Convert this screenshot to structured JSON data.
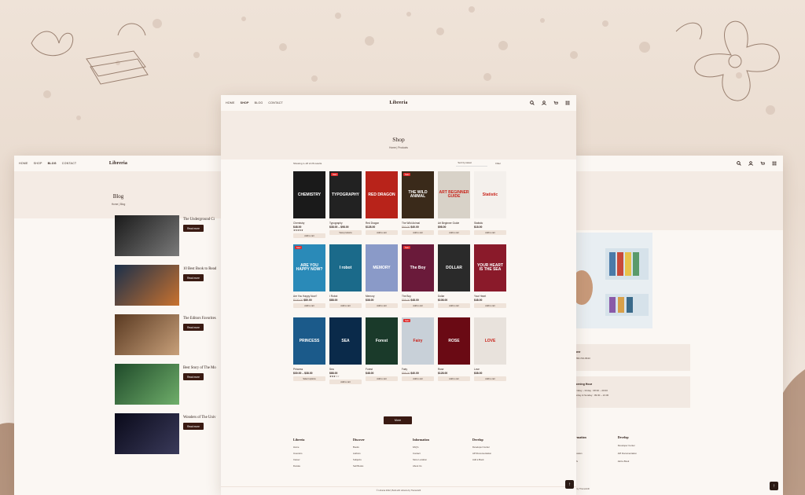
{
  "left_page": {
    "nav": [
      "HOME",
      "SHOP",
      "BLOG",
      "CONTACT"
    ],
    "logo": "Libreria",
    "banner_title": "Blog",
    "breadcrumb": "Home | Blog",
    "posts": [
      {
        "title": "The Underground Ci",
        "colors": [
          "#1a1a1a",
          "#7a7a7a"
        ]
      },
      {
        "title": "10 Best Book to Read",
        "colors": [
          "#1b2f4a",
          "#c9722f"
        ]
      },
      {
        "title": "The Editors Favorites",
        "colors": [
          "#5a3a22",
          "#c8a07a"
        ]
      },
      {
        "title": "Best Story of The Mo",
        "colors": [
          "#1f4a2a",
          "#6fae6a"
        ]
      },
      {
        "title": "Wonders of The Univ",
        "colors": [
          "#0a0a1a",
          "#3a3a5a"
        ]
      }
    ],
    "read_more": "Read more"
  },
  "main_page": {
    "nav": [
      "HOME",
      "SHOP",
      "BLOG",
      "CONTACT"
    ],
    "logo": "Libreria",
    "banner_title": "Shop",
    "breadcrumb": "Home | Products",
    "result_count": "Showing 1–18 of 26 results",
    "sort": "Sort by latest",
    "filter": "Filter",
    "more": "More",
    "products": [
      {
        "name": "Chemistry",
        "price": "$48.00",
        "old": "",
        "cta": "Add to cart",
        "stars": "★★★★★",
        "cover_text": "CHEMISTRY",
        "bg": "#1a1a1a",
        "sale": ""
      },
      {
        "name": "Typography",
        "price": "$38.00 – $98.00",
        "old": "",
        "cta": "View products",
        "stars": "",
        "cover_text": "TYPOGRAPHY",
        "bg": "#222222",
        "sale": "Sale!"
      },
      {
        "name": "Red Dragon",
        "price": "$128.00",
        "old": "",
        "cta": "Add to cart",
        "stars": "",
        "cover_text": "RED DRAGON",
        "bg": "#b8231a",
        "sale": ""
      },
      {
        "name": "The Wild Animal",
        "price": "$40.00",
        "old": "$60.00",
        "cta": "Add to cart",
        "stars": "",
        "cover_text": "THE WILD ANIMAL",
        "bg": "#3a2a1a",
        "sale": "Sale!"
      },
      {
        "name": "Art Beginner Guide",
        "price": "$98.00",
        "old": "",
        "cta": "Add to cart",
        "stars": "",
        "cover_text": "ART BEGINNER GUIDE",
        "bg": "#d8d2c8",
        "sale": ""
      },
      {
        "name": "Statistic",
        "price": "$18.00",
        "old": "",
        "cta": "Add to cart",
        "stars": "",
        "cover_text": "Statistic",
        "bg": "#f4f0ec",
        "sale": ""
      },
      {
        "name": "Are You Happy Now?",
        "price": "$80.00",
        "old": "$100.00",
        "cta": "Add to cart",
        "stars": "",
        "cover_text": "ARE YOU HAPPY NOW?",
        "bg": "#2a8ab8",
        "sale": "Sale!"
      },
      {
        "name": "I Robot",
        "price": "$88.00",
        "old": "",
        "cta": "Add to cart",
        "stars": "",
        "cover_text": "I robot",
        "bg": "#1b6a8a",
        "sale": ""
      },
      {
        "name": "Memory",
        "price": "$38.00",
        "old": "",
        "cta": "Add to cart",
        "stars": "",
        "cover_text": "MEMORY",
        "bg": "#8a9ac8",
        "sale": ""
      },
      {
        "name": "The Boy",
        "price": "$48.00",
        "old": "$58.00",
        "cta": "Add to cart",
        "stars": "",
        "cover_text": "The Boy",
        "bg": "#6a1a3a",
        "sale": "Sale!"
      },
      {
        "name": "Dollar",
        "price": "$108.00",
        "old": "",
        "cta": "Add to cart",
        "stars": "",
        "cover_text": "DOLLAR",
        "bg": "#2a2a2a",
        "sale": ""
      },
      {
        "name": "Your Heart",
        "price": "$48.00",
        "old": "",
        "cta": "Add to cart",
        "stars": "",
        "cover_text": "YOUR HEART IS THE SEA",
        "bg": "#8a1a2a",
        "sale": ""
      },
      {
        "name": "Princess",
        "price": "$30.00 – $38.00",
        "old": "",
        "cta": "Select options",
        "stars": "",
        "cover_text": "PRINCESS",
        "bg": "#1b5a8a",
        "sale": ""
      },
      {
        "name": "Sea",
        "price": "$88.00",
        "old": "",
        "cta": "Add to cart",
        "stars": "★★★☆☆",
        "cover_text": "SEA",
        "bg": "#0a2a4a",
        "sale": ""
      },
      {
        "name": "Forest",
        "price": "$48.00",
        "old": "",
        "cta": "Add to cart",
        "stars": "",
        "cover_text": "Forest",
        "bg": "#1a3a2a",
        "sale": ""
      },
      {
        "name": "Fairy",
        "price": "$40.00",
        "old": "$58.00",
        "cta": "Add to cart",
        "stars": "",
        "cover_text": "Fairy",
        "bg": "#c8d0d8",
        "sale": "Sale!"
      },
      {
        "name": "Rose",
        "price": "$128.00",
        "old": "",
        "cta": "Add to cart",
        "stars": "",
        "cover_text": "ROSE",
        "bg": "#6a0a14",
        "sale": ""
      },
      {
        "name": "Love",
        "price": "$38.00",
        "old": "",
        "cta": "Add to cart",
        "stars": "",
        "cover_text": "LOVE",
        "bg": "#e8e2dc",
        "sale": ""
      }
    ],
    "footer": [
      {
        "heading": "Libreria",
        "links": [
          "Home",
          "Inventors",
          "Career",
          "Donate"
        ]
      },
      {
        "heading": "Discover",
        "links": [
          "Books",
          "Authors",
          "Subjects",
          "Sell Books"
        ]
      },
      {
        "heading": "Information",
        "links": [
          "FAQ's",
          "Contact",
          "Store Location",
          "About Us"
        ]
      },
      {
        "heading": "Develop",
        "links": [
          "Developer Center",
          "API Documentation",
          "Add a Book"
        ]
      }
    ],
    "copyright": "© Libreria 2022 | Built with Libreria by ThemeGrill"
  },
  "right_page": {
    "box1_heading": "one",
    "box1_line": "258-700-6543",
    "box2_heading": "pening Hour",
    "box2_lines": [
      "Friday – Friday : 08:30 – 20:00",
      "urday & Sunday : 09:30 – 21:30"
    ],
    "footer": [
      {
        "heading": "ormation",
        "links": [
          "s",
          "Location",
          "t Us"
        ]
      },
      {
        "heading": "Develop",
        "links": [
          "Developer Center",
          "API Documentation",
          "Add a Book"
        ]
      }
    ],
    "copyright": "ria by ThemeGrill"
  },
  "colors": {
    "accent": "#3a1a12",
    "soft": "#efe3d9",
    "sale": "#e02a2a"
  }
}
